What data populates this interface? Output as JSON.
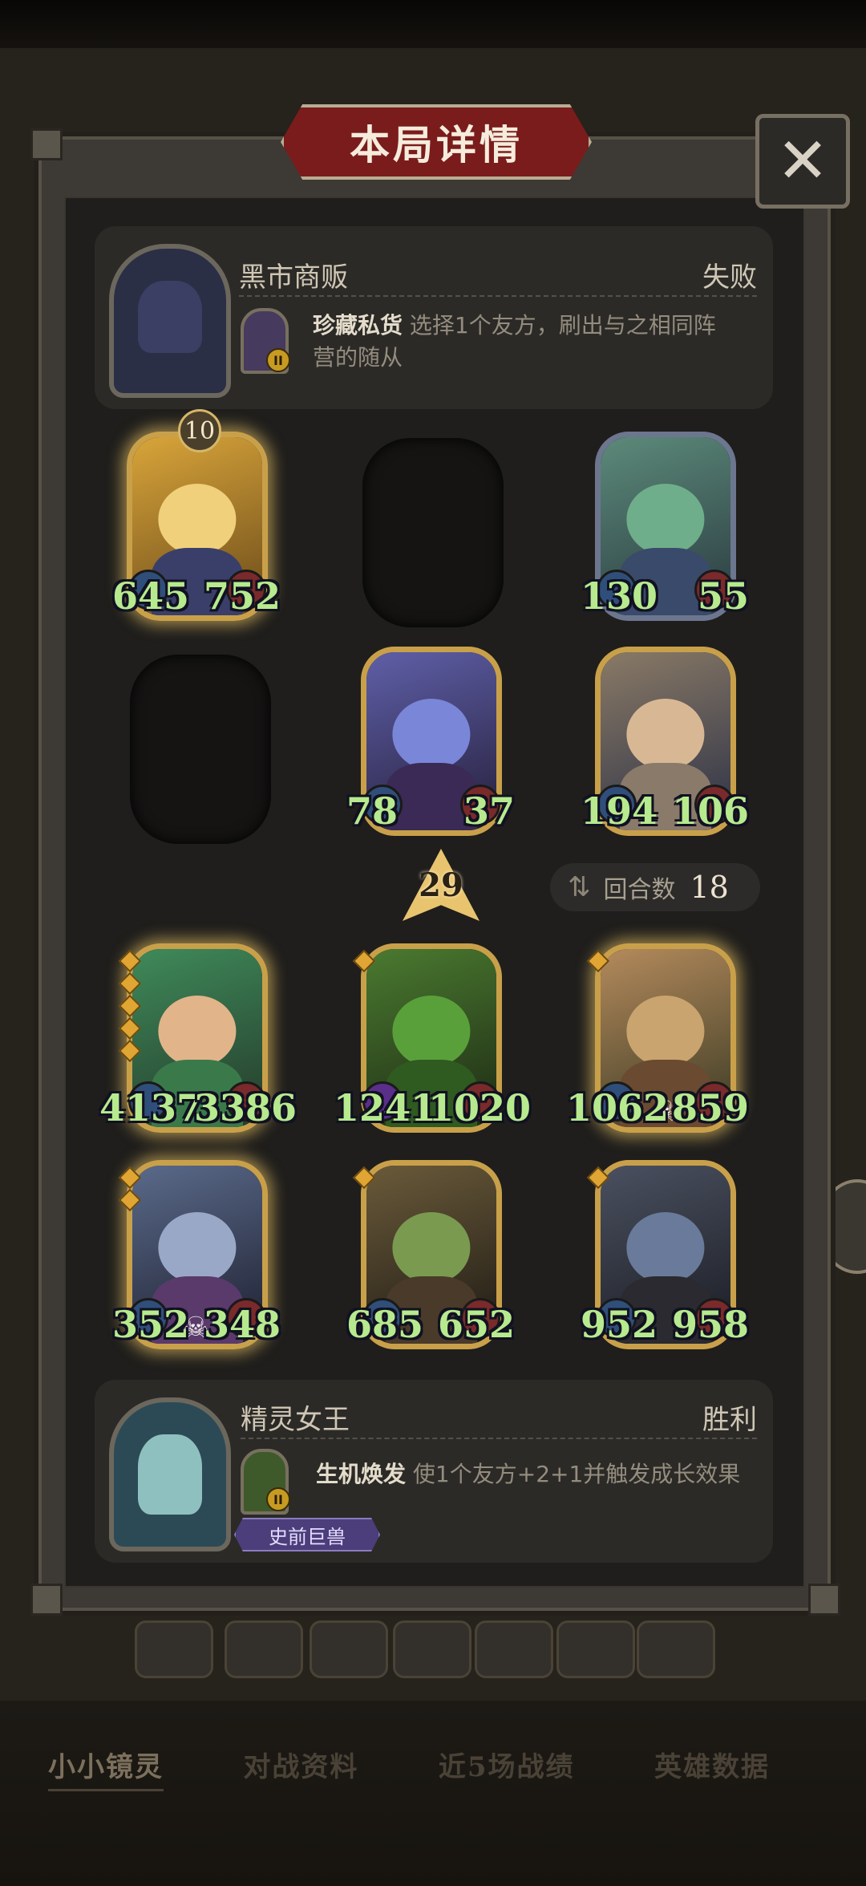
{
  "dialog": {
    "title": "本局详情",
    "close_icon": "close-icon"
  },
  "opponent": {
    "name": "黑市商贩",
    "result": "失败",
    "trinket_level": "II",
    "skill_name": "珍藏私货",
    "skill_desc": "选择1个友方，刷出与之相同阵",
    "skill_desc2": "营的随从"
  },
  "opponent_board": [
    {
      "id": "card-spiky-hero",
      "attack": "645",
      "health": "752",
      "tier": "10",
      "color": "#d9a53a"
    },
    {
      "id": "card-frog-banker",
      "attack": "130",
      "health": "55",
      "color": "#5c8a7a"
    },
    {
      "id": "card-star-witch",
      "attack": "78",
      "health": "37",
      "color": "#5f5fa8"
    },
    {
      "id": "card-dwarf-king",
      "attack": "194",
      "health": "106",
      "color": "#8a7a66"
    }
  ],
  "tavern_level": "29",
  "round": {
    "label": "回合数",
    "value": "18"
  },
  "player_board": [
    {
      "id": "card-fairy-druid",
      "attack": "4137",
      "health": "3386",
      "color": "#3f8a5a"
    },
    {
      "id": "card-treant",
      "attack": "1241",
      "health": "1020",
      "color": "#4a7a30"
    },
    {
      "id": "card-sunflower-girl",
      "attack": "1062",
      "health": "859",
      "color": "#b48a5c"
    },
    {
      "id": "card-naga-siren",
      "attack": "352",
      "health": "348",
      "color": "#5a6a8a"
    },
    {
      "id": "card-goblin-witch",
      "attack": "685",
      "health": "652",
      "color": "#6a5a3a"
    },
    {
      "id": "card-mushroom-beast",
      "attack": "952",
      "health": "958",
      "color": "#4a5060"
    }
  ],
  "player": {
    "name": "精灵女王",
    "result": "胜利",
    "trinket_level": "II",
    "skill_name": "生机焕发",
    "skill_desc": "使1个友方+2+1并触发成长效果",
    "tribe_tag": "史前巨兽"
  },
  "bottom_tabs": [
    "小小镜灵",
    "对战资料",
    "近5场战绩",
    "英雄数据"
  ]
}
